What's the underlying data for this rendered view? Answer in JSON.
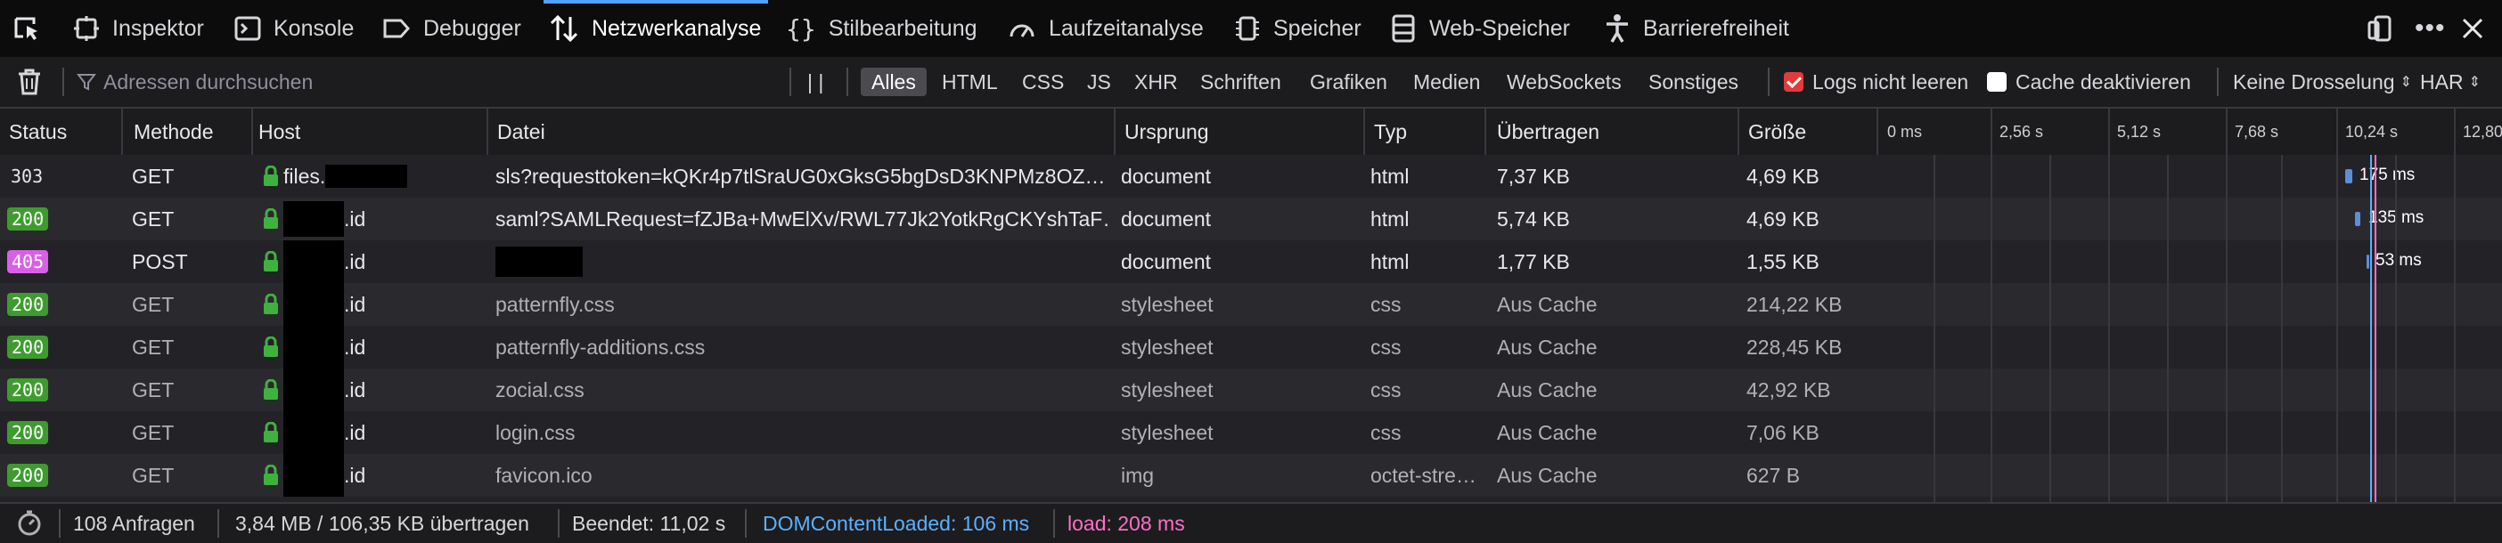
{
  "tabs": [
    {
      "label": "Inspektor",
      "icon": "inspector-icon"
    },
    {
      "label": "Konsole",
      "icon": "console-icon"
    },
    {
      "label": "Debugger",
      "icon": "debugger-icon"
    },
    {
      "label": "Netzwerkanalyse",
      "icon": "network-icon",
      "active": true
    },
    {
      "label": "Stilbearbeitung",
      "icon": "style-editor-icon"
    },
    {
      "label": "Laufzeitanalyse",
      "icon": "performance-icon"
    },
    {
      "label": "Speicher",
      "icon": "memory-icon"
    },
    {
      "label": "Web-Speicher",
      "icon": "storage-icon"
    },
    {
      "label": "Barrierefreiheit",
      "icon": "accessibility-icon"
    }
  ],
  "toolbar": {
    "search_placeholder": "Adressen durchsuchen",
    "pause_label": "| |",
    "filters": [
      "Alles",
      "HTML",
      "CSS",
      "JS",
      "XHR",
      "Schriften",
      "Grafiken",
      "Medien",
      "WebSockets",
      "Sonstiges"
    ],
    "active_filter": "Alles",
    "persist_logs": {
      "label": "Logs nicht leeren",
      "checked": true
    },
    "disable_cache": {
      "label": "Cache deaktivieren",
      "checked": false
    },
    "throttling": "Keine Drosselung",
    "har": "HAR"
  },
  "columns": [
    "Status",
    "Methode",
    "Host",
    "Datei",
    "Ursprung",
    "Typ",
    "Übertragen",
    "Größe"
  ],
  "timeline_ticks": [
    "0 ms",
    "2,56 s",
    "5,12 s",
    "7,68 s",
    "10,24 s",
    "12,80"
  ],
  "rows": [
    {
      "status": "303",
      "method": "GET",
      "host": "files.",
      "file": "sls?requesttoken=kQKr4p7tlSraUG0xGksG5bgDsD3KNPMz8OZ…",
      "origin": "document",
      "type": "html",
      "transferred": "7,37 KB",
      "size": "4,69 KB",
      "time": "175 ms",
      "cached": false,
      "status_kind": "plain"
    },
    {
      "status": "200",
      "method": "GET",
      "host": ".id",
      "file": "saml?SAMLRequest=fZJBa+MwElXv/RWL77Jk2YotkRgCKYshTaF…",
      "origin": "document",
      "type": "html",
      "transferred": "5,74 KB",
      "size": "4,69 KB",
      "time": "135 ms",
      "cached": false,
      "status_kind": "ok"
    },
    {
      "status": "405",
      "method": "POST",
      "host": ".id",
      "file": "",
      "origin": "document",
      "type": "html",
      "transferred": "1,77 KB",
      "size": "1,55 KB",
      "time": "53 ms",
      "cached": false,
      "status_kind": "post"
    },
    {
      "status": "200",
      "method": "GET",
      "host": ".id",
      "file": "patternfly.css",
      "origin": "stylesheet",
      "type": "css",
      "transferred": "Aus Cache",
      "size": "214,22 KB",
      "time": "",
      "cached": true,
      "status_kind": "ok"
    },
    {
      "status": "200",
      "method": "GET",
      "host": ".id",
      "file": "patternfly-additions.css",
      "origin": "stylesheet",
      "type": "css",
      "transferred": "Aus Cache",
      "size": "228,45 KB",
      "time": "",
      "cached": true,
      "status_kind": "ok"
    },
    {
      "status": "200",
      "method": "GET",
      "host": ".id",
      "file": "zocial.css",
      "origin": "stylesheet",
      "type": "css",
      "transferred": "Aus Cache",
      "size": "42,92 KB",
      "time": "",
      "cached": true,
      "status_kind": "ok"
    },
    {
      "status": "200",
      "method": "GET",
      "host": ".id",
      "file": "login.css",
      "origin": "stylesheet",
      "type": "css",
      "transferred": "Aus Cache",
      "size": "7,06 KB",
      "time": "",
      "cached": true,
      "status_kind": "ok"
    },
    {
      "status": "200",
      "method": "GET",
      "host": ".id",
      "file": "favicon.ico",
      "origin": "img",
      "type": "octet-stre…",
      "transferred": "Aus Cache",
      "size": "627 B",
      "time": "",
      "cached": true,
      "status_kind": "ok"
    }
  ],
  "statusbar": {
    "requests": "108 Anfragen",
    "transferred": "3,84 MB / 106,35 KB übertragen",
    "finished": "Beendet: 11,02 s",
    "domcontentloaded": "DOMContentLoaded: 106 ms",
    "load": "load: 208 ms"
  },
  "colors": {
    "accent": "#4da3ff",
    "status_ok": "#3e9c2f",
    "status_post": "#d860e6",
    "dom_loaded": "#5cb0ff",
    "load": "#ff6ec7"
  }
}
